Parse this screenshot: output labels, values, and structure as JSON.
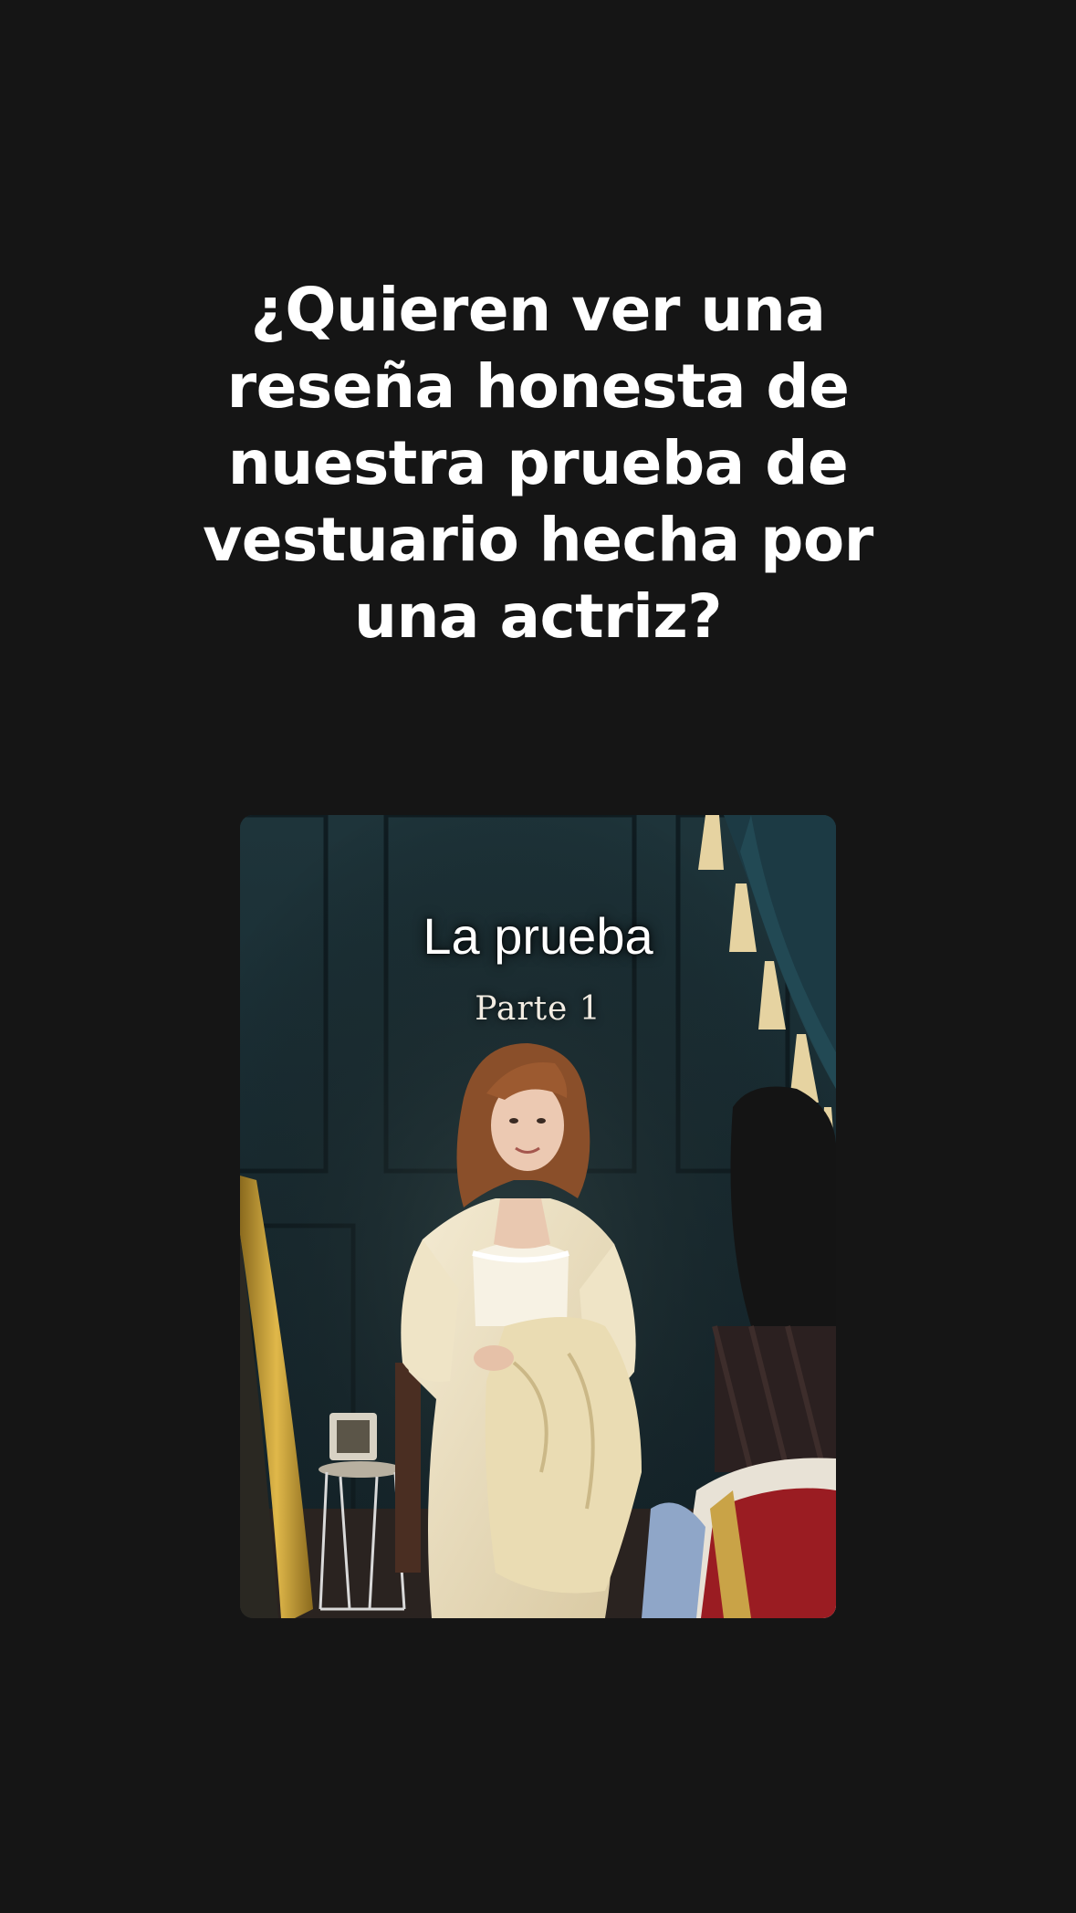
{
  "headline": {
    "lines": [
      "¿Quieren ver una",
      "reseña honesta de",
      "nuestra prueba de",
      "vestuario hecha por",
      "una actriz?"
    ]
  },
  "video": {
    "title": "La prueba",
    "subtitle": "Parte 1",
    "image": "photo-actress-costume-fitting"
  },
  "colors": {
    "background": "#151515",
    "text": "#ffffff",
    "wall": "#1b3036"
  }
}
